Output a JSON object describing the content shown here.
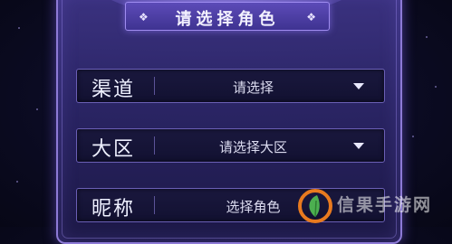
{
  "dialog": {
    "title": "请选择角色"
  },
  "fields": [
    {
      "label": "渠道",
      "value": "请选择"
    },
    {
      "label": "大区",
      "value": "请选择大区"
    },
    {
      "label": "昵称",
      "value": "选择角色"
    }
  ],
  "watermark": {
    "text": "信果手游网"
  },
  "colors": {
    "panel": "#3f3391",
    "panel_border": "#8d7ad6",
    "field_bg": "#15143a",
    "text": "#eef0ff",
    "watermark_orange": "#e87a1f",
    "watermark_green": "#4caf50"
  },
  "icons": {
    "dropdown": "caret-down-icon",
    "title_ornament": "diamond-ornament-icon"
  }
}
